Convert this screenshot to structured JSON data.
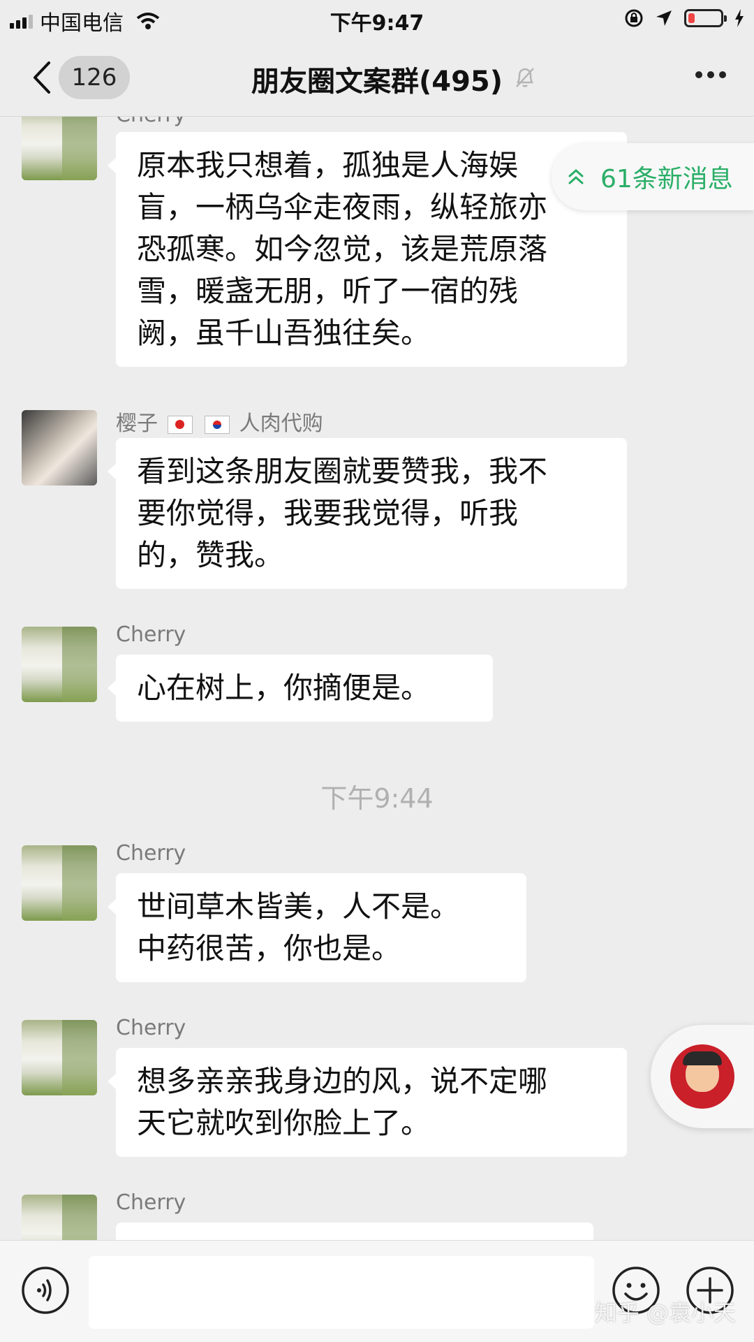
{
  "status_bar": {
    "carrier": "中国电信",
    "time": "下午9:47",
    "battery_level": 0.2,
    "battery_color": "#f04545"
  },
  "nav": {
    "back_icon": "chevron-left-icon",
    "unread_count": "126",
    "title": "朋友圈文案群(495)",
    "mute_icon": "bell-off-icon",
    "more_icon": "more-dots-icon"
  },
  "new_messages": {
    "label": "61条新消息",
    "icon": "double-chevron-up-icon",
    "color": "#2aae67"
  },
  "messages": [
    {
      "sender": "Cherry",
      "text": [
        "原本我只想着，孤独是人海娱",
        "盲，一柄乌伞走夜雨，纵轻旅亦",
        "恐孤寒。如今忽觉，该是荒原落",
        "雪，暖盏无朋，听了一宿的残",
        "阙，虽千山吾独往矣。"
      ]
    },
    {
      "sender": "樱子",
      "sender_suffix": "人肉代购",
      "flags": [
        "japan-flag-icon",
        "korea-flag-icon"
      ],
      "text": [
        "看到这条朋友圈就要赞我，我不",
        "要你觉得，我要我觉得，听我",
        "的，赞我。"
      ]
    },
    {
      "sender": "Cherry",
      "text": [
        "心在树上，你摘便是。"
      ]
    },
    {
      "sender": "Cherry",
      "text": [
        "世间草木皆美，人不是。",
        "中药很苦，你也是。"
      ]
    },
    {
      "sender": "Cherry",
      "text": [
        "想多亲亲我身边的风，说不定哪",
        "天它就吹到你脸上了。"
      ]
    },
    {
      "sender": "Cherry"
    }
  ],
  "timestamp": "下午9:44",
  "input_bar": {
    "voice_icon": "voice-icon",
    "emoji_icon": "emoji-icon",
    "plus_icon": "plus-icon",
    "watermark": "知乎 @袁小天"
  }
}
